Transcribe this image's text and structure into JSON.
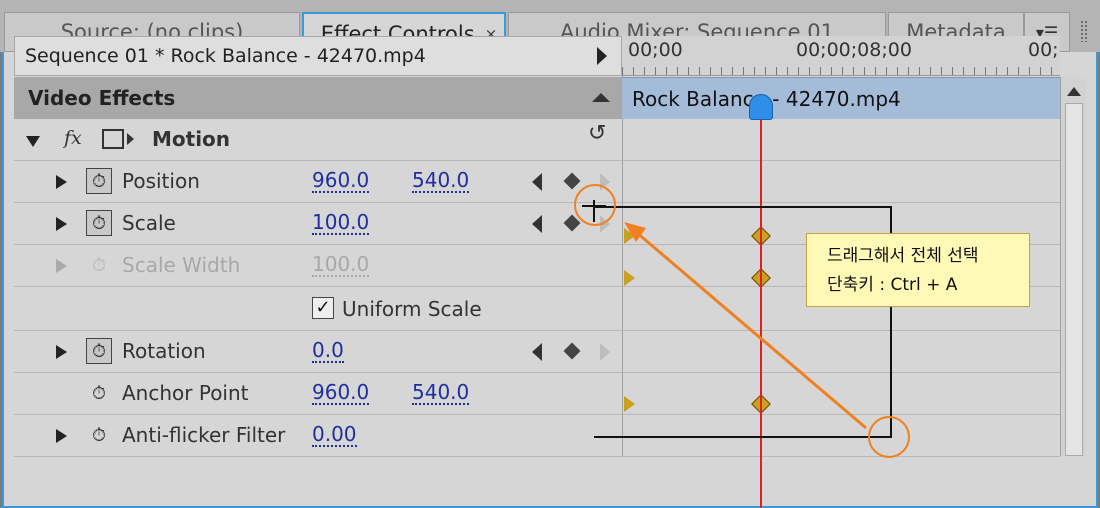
{
  "tabs": [
    {
      "label": "Source: (no clips)"
    },
    {
      "label": "Effect Controls",
      "close": "×"
    },
    {
      "label": "Audio Mixer: Sequence 01"
    },
    {
      "label": "Metadata"
    }
  ],
  "panel_menu_glyph": "▾☰",
  "sequence_label": "Sequence 01 * Rock Balance - 42470.mp4",
  "section_title": "Video Effects",
  "motion": {
    "fx": "fx",
    "label": "Motion",
    "reset_glyph": "↺"
  },
  "rows": {
    "position": {
      "label": "Position",
      "x": "960.0",
      "y": "540.0"
    },
    "scale": {
      "label": "Scale",
      "value": "100.0"
    },
    "scale_width": {
      "label": "Scale Width",
      "value": "100.0"
    },
    "uniform_scale": {
      "label": "Uniform Scale",
      "check": "✓"
    },
    "rotation": {
      "label": "Rotation",
      "value": "0.0"
    },
    "anchor_point": {
      "label": "Anchor Point",
      "x": "960.0",
      "y": "540.0"
    },
    "anti_flicker": {
      "label": "Anti-flicker Filter",
      "value": "0.00"
    }
  },
  "stopwatch_glyph": "⏱",
  "timeline": {
    "ruler_ticks": [
      "00;00",
      "00;00;08;00",
      "00;"
    ],
    "clip_name": "Rock Balance - 42470.mp4"
  },
  "callout": {
    "line1": "드래그해서 전체 선택",
    "line2": "단축키 : Ctrl + A"
  },
  "colors": {
    "accent": "#3a9ad9",
    "value_link": "#1f2fa0",
    "playhead": "#e02020",
    "clip_bar": "#a4bcd8",
    "keyframe": "#c9a020",
    "annotation": "#f08020",
    "callout_bg": "#fff9b8"
  }
}
